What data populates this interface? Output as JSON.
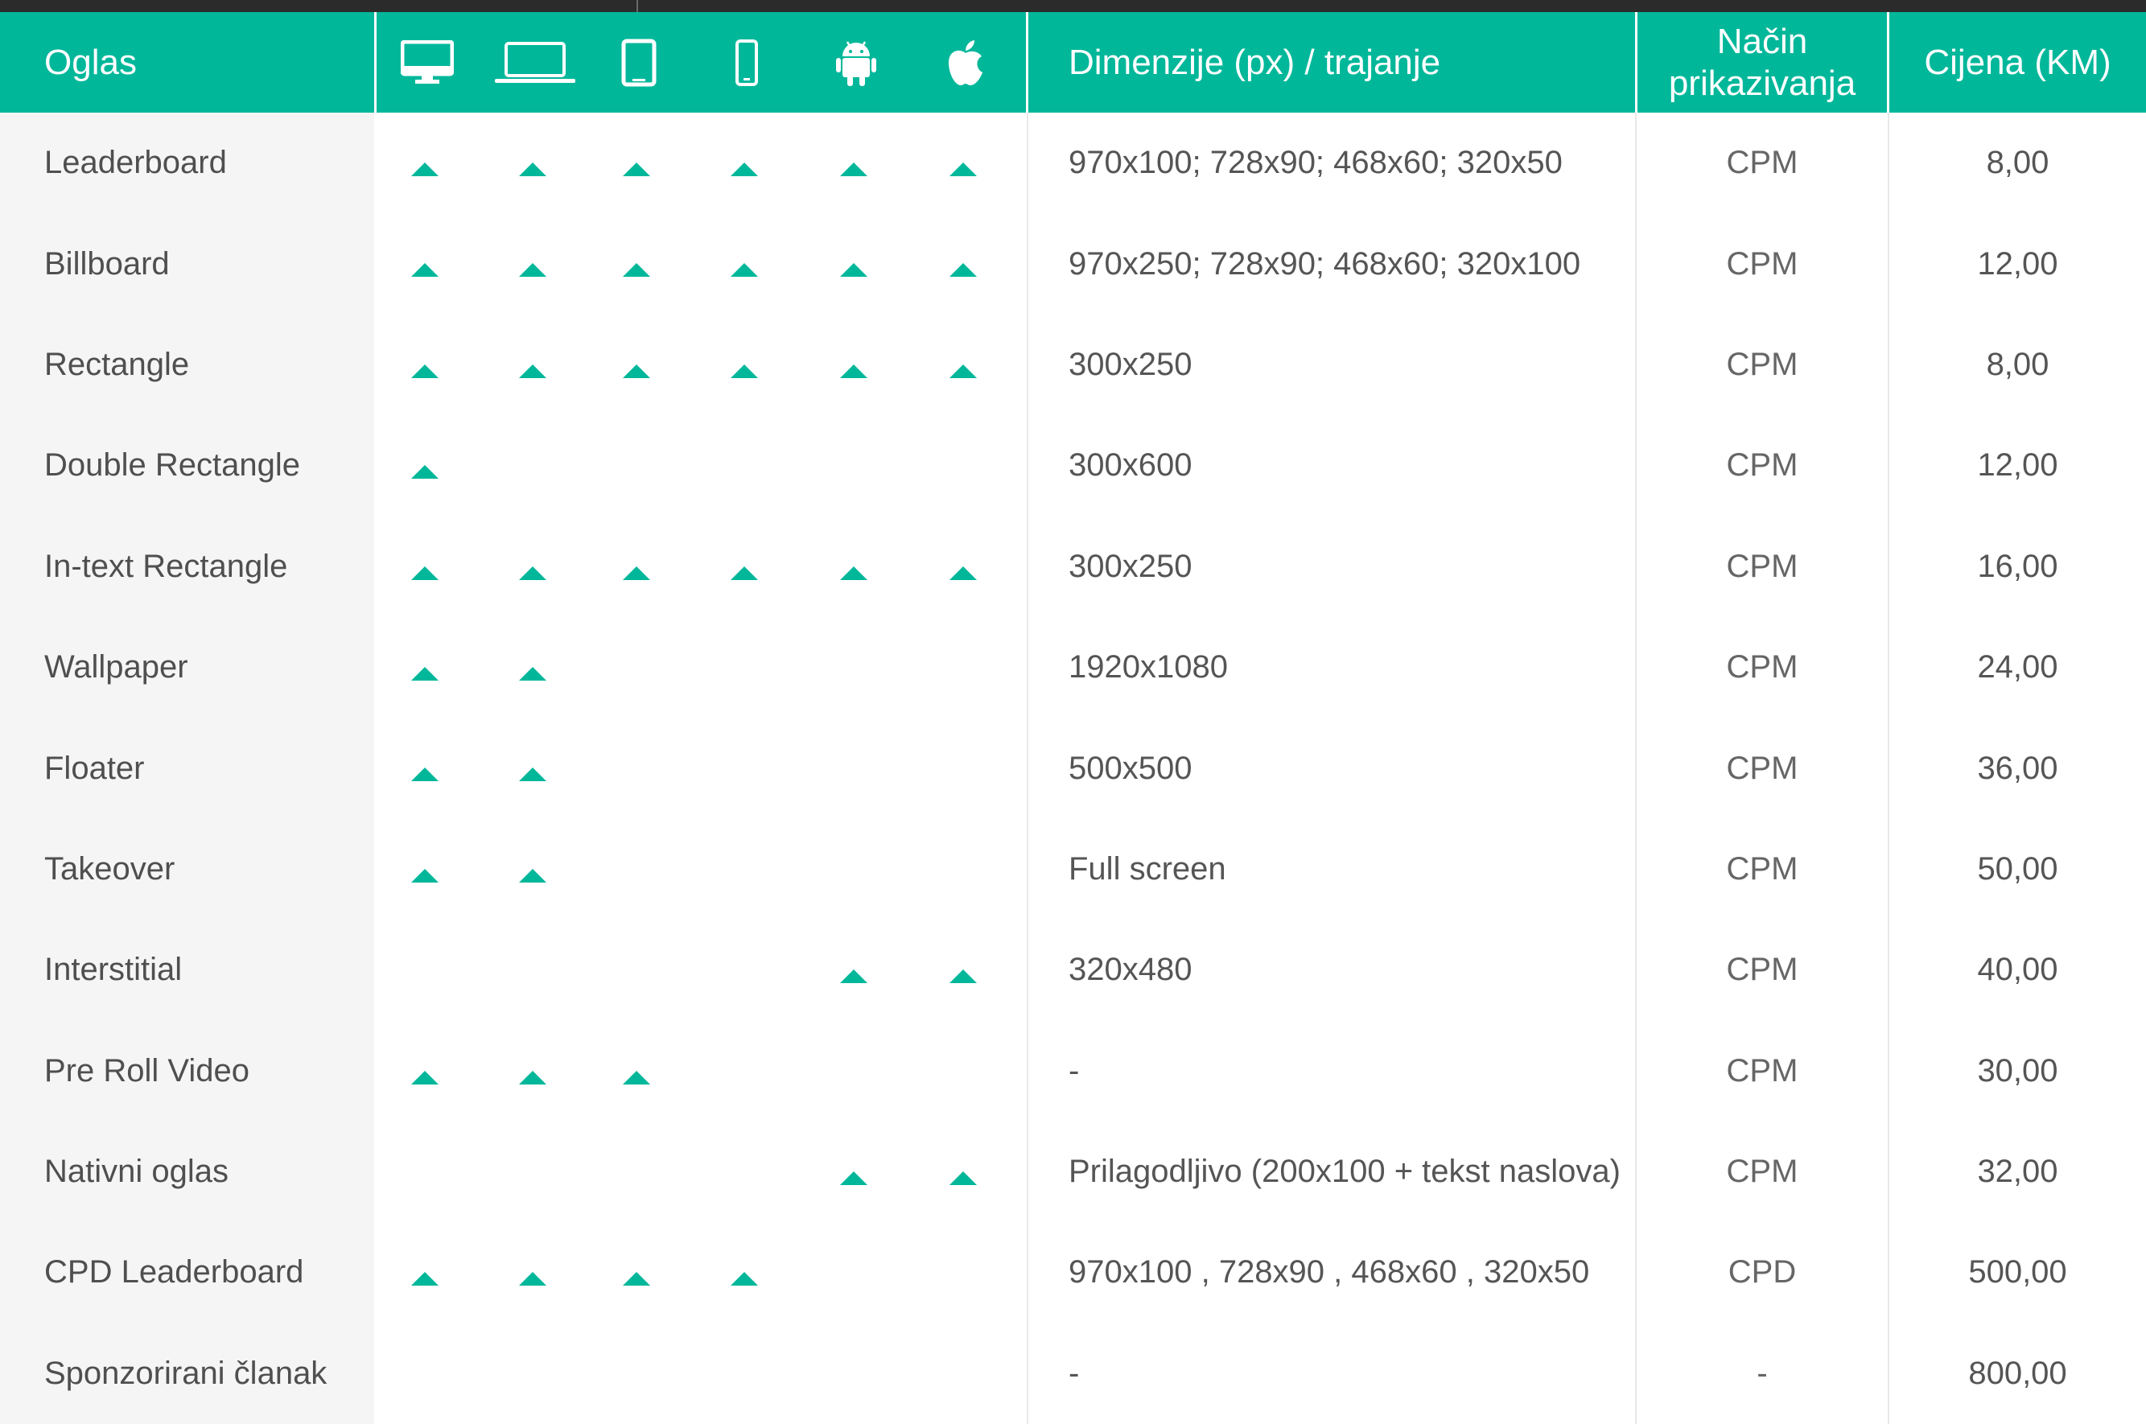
{
  "header": {
    "ad_label": "Oglas",
    "dimensions_label": "Dimenzije (px) / trajanje",
    "mode_label_line1": "Način",
    "mode_label_line2": "prikazivanja",
    "price_label": "Cijena (KM)",
    "device_icons": [
      "desktop-icon",
      "laptop-icon",
      "tablet-icon",
      "phone-icon",
      "android-icon",
      "apple-icon"
    ]
  },
  "colors": {
    "accent": "#00b79a",
    "name_column_bg": "#f5f5f5",
    "top_bar": "#2b2b2b"
  },
  "rows": [
    {
      "name": "Leaderboard",
      "devices": [
        1,
        1,
        1,
        1,
        1,
        1
      ],
      "dimensions": "970x100; 728x90; 468x60; 320x50",
      "mode": "CPM",
      "price": "8,00"
    },
    {
      "name": "Billboard",
      "devices": [
        1,
        1,
        1,
        1,
        1,
        1
      ],
      "dimensions": "970x250; 728x90; 468x60; 320x100",
      "mode": "CPM",
      "price": "12,00"
    },
    {
      "name": "Rectangle",
      "devices": [
        1,
        1,
        1,
        1,
        1,
        1
      ],
      "dimensions": "300x250",
      "mode": "CPM",
      "price": "8,00"
    },
    {
      "name": "Double Rectangle",
      "devices": [
        1,
        0,
        0,
        0,
        0,
        0
      ],
      "dimensions": "300x600",
      "mode": "CPM",
      "price": "12,00"
    },
    {
      "name": "In-text Rectangle",
      "devices": [
        1,
        1,
        1,
        1,
        1,
        1
      ],
      "dimensions": "300x250",
      "mode": "CPM",
      "price": "16,00"
    },
    {
      "name": "Wallpaper",
      "devices": [
        1,
        1,
        0,
        0,
        0,
        0
      ],
      "dimensions": "1920x1080",
      "mode": "CPM",
      "price": "24,00"
    },
    {
      "name": "Floater",
      "devices": [
        1,
        1,
        0,
        0,
        0,
        0
      ],
      "dimensions": "500x500",
      "mode": "CPM",
      "price": "36,00"
    },
    {
      "name": "Takeover",
      "devices": [
        1,
        1,
        0,
        0,
        0,
        0
      ],
      "dimensions": "Full screen",
      "mode": "CPM",
      "price": "50,00"
    },
    {
      "name": "Interstitial",
      "devices": [
        0,
        0,
        0,
        0,
        1,
        1
      ],
      "dimensions": "320x480",
      "mode": "CPM",
      "price": "40,00"
    },
    {
      "name": "Pre Roll Video",
      "devices": [
        1,
        1,
        1,
        0,
        0,
        0
      ],
      "dimensions": "-",
      "mode": "CPM",
      "price": "30,00"
    },
    {
      "name": "Nativni oglas",
      "devices": [
        0,
        0,
        0,
        0,
        1,
        1
      ],
      "dimensions": "Prilagodljivo (200x100 + tekst naslova)",
      "mode": "CPM",
      "price": "32,00"
    },
    {
      "name": "CPD Leaderboard",
      "devices": [
        1,
        1,
        1,
        1,
        0,
        0
      ],
      "dimensions": "970x100 , 728x90 , 468x60 , 320x50",
      "mode": "CPD",
      "price": "500,00"
    },
    {
      "name": "Sponzorirani članak",
      "devices": [
        0,
        0,
        0,
        0,
        0,
        0
      ],
      "dimensions": "-",
      "mode": "-",
      "price": "800,00"
    }
  ]
}
